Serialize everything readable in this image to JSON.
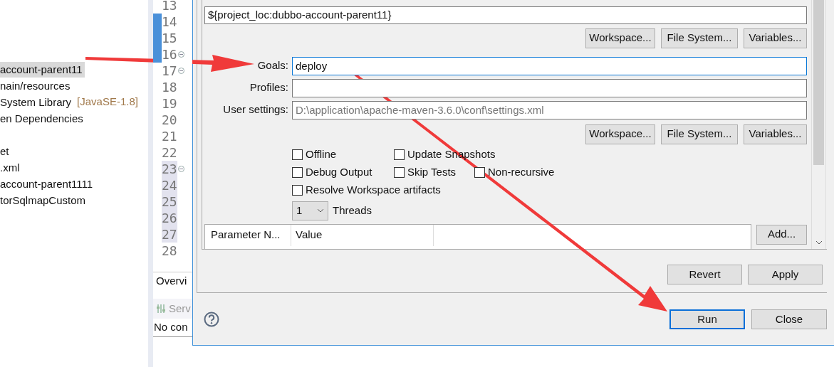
{
  "package_explorer": {
    "items": [
      {
        "label": "account-parent11",
        "selected": true
      },
      {
        "label": "nain/resources",
        "selected": false
      },
      {
        "label": "System Library",
        "decoration": "[JavaSE-1.8]",
        "selected": false
      },
      {
        "label": "en Dependencies",
        "selected": false
      },
      {
        "label": "et",
        "selected": false,
        "gap_before": true
      },
      {
        "label": ".xml",
        "selected": false
      },
      {
        "label": "account-parent1111",
        "selected": false
      },
      {
        "label": "torSqlmapCustom",
        "selected": false
      }
    ]
  },
  "editor": {
    "lines": [
      {
        "number": "13",
        "changed": false,
        "fold": false,
        "highlighted": false
      },
      {
        "number": "14",
        "changed": true,
        "fold": false,
        "highlighted": false
      },
      {
        "number": "15",
        "changed": true,
        "fold": false,
        "highlighted": false
      },
      {
        "number": "16",
        "changed": true,
        "fold": true,
        "highlighted": false
      },
      {
        "number": "17",
        "changed": false,
        "fold": true,
        "highlighted": false
      },
      {
        "number": "18",
        "changed": false,
        "fold": false,
        "highlighted": false
      },
      {
        "number": "19",
        "changed": false,
        "fold": false,
        "highlighted": false
      },
      {
        "number": "20",
        "changed": false,
        "fold": false,
        "highlighted": false
      },
      {
        "number": "21",
        "changed": false,
        "fold": false,
        "highlighted": false
      },
      {
        "number": "22",
        "changed": false,
        "fold": false,
        "highlighted": false
      },
      {
        "number": "23",
        "changed": false,
        "fold": true,
        "highlighted": true
      },
      {
        "number": "24",
        "changed": false,
        "fold": false,
        "highlighted": true
      },
      {
        "number": "25",
        "changed": false,
        "fold": false,
        "highlighted": true
      },
      {
        "number": "26",
        "changed": false,
        "fold": false,
        "highlighted": true
      },
      {
        "number": "27",
        "changed": false,
        "fold": false,
        "highlighted": true
      },
      {
        "number": "28",
        "changed": false,
        "fold": false,
        "highlighted": false
      }
    ],
    "bottom_tab": "Overvi"
  },
  "servers_view": {
    "title": "Serv",
    "message": "No con"
  },
  "dialog": {
    "base_directory": {
      "value": "${project_loc:dubbo-account-parent11}"
    },
    "base_buttons": [
      "Workspace...",
      "File System...",
      "Variables..."
    ],
    "fields": [
      {
        "label": "Goals:",
        "value": "deploy",
        "focused": true
      },
      {
        "label": "Profiles:",
        "focused": false
      },
      {
        "label": "User settings:",
        "placeholder": "D:\\application\\apache-maven-3.6.0\\conf\\settings.xml",
        "focused": false
      }
    ],
    "settings_buttons": [
      "Workspace...",
      "File System...",
      "Variables..."
    ],
    "options": [
      [
        {
          "label": "Offline",
          "checked": false
        },
        {
          "label": "Update Snapshots",
          "checked": false
        }
      ],
      [
        {
          "label": "Debug Output",
          "checked": false
        },
        {
          "label": "Skip Tests",
          "checked": false
        },
        {
          "label": "Non-recursive",
          "checked": false
        }
      ],
      [
        {
          "label": "Resolve Workspace artifacts",
          "checked": false
        }
      ]
    ],
    "threads": {
      "value": "1",
      "label": "Threads"
    },
    "parameters": {
      "columns": [
        "Parameter N...",
        "Value"
      ]
    },
    "add_button": "Add...",
    "panel_buttons": [
      "Revert",
      "Apply"
    ],
    "footer_buttons": [
      {
        "label": "Run",
        "default": true
      },
      {
        "label": "Close",
        "default": false
      }
    ]
  }
}
